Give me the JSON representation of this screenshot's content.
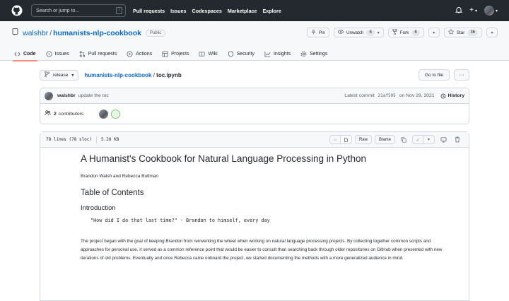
{
  "topbar": {
    "search_placeholder": "Search or jump to...",
    "search_shortcut": "/",
    "nav": [
      "Pull requests",
      "Issues",
      "Codespaces",
      "Marketplace",
      "Explore"
    ]
  },
  "repo": {
    "owner": "walshbr",
    "separator": "/",
    "name": "humanists-nlp-cookbook",
    "visibility": "Public",
    "pin_label": "Pin",
    "unwatch_label": "Unwatch",
    "watch_count": "6",
    "fork_label": "Fork",
    "fork_count": "6",
    "star_label": "Star",
    "star_count": "36"
  },
  "tabs": [
    {
      "label": "Code",
      "icon": "code-icon"
    },
    {
      "label": "Issues",
      "icon": "issue-icon"
    },
    {
      "label": "Pull requests",
      "icon": "pull-request-icon"
    },
    {
      "label": "Actions",
      "icon": "play-icon"
    },
    {
      "label": "Projects",
      "icon": "table-icon"
    },
    {
      "label": "Wiki",
      "icon": "book-icon"
    },
    {
      "label": "Security",
      "icon": "shield-icon"
    },
    {
      "label": "Insights",
      "icon": "graph-icon"
    },
    {
      "label": "Settings",
      "icon": "gear-icon"
    }
  ],
  "path": {
    "branch": "release",
    "repo_link": "humanists-nlp-cookbook",
    "separator": "/",
    "file": "toc.ipynb",
    "go_to_file": "Go to file",
    "more": "···"
  },
  "commit": {
    "author": "walshbr",
    "message": "update the toc",
    "latest_label": "Latest commit",
    "sha": "21af595",
    "date_prefix": "on",
    "date": "Nov 29, 2021",
    "history_label": "History",
    "contributors_count": "2",
    "contributors_label": "contributors"
  },
  "file": {
    "lines": "78 lines (78 sloc)",
    "size": "5.28 KB",
    "raw_label": "Raw",
    "blame_label": "Blame"
  },
  "notebook": {
    "title": "A Humanist's Cookbook for Natural Language Processing in Python",
    "authors": "Brandon Walsh and Rebecca Bultman",
    "toc_heading": "Table of Contents",
    "intro_heading": "Introduction",
    "quote": "\"How did I do that last time?\" - Brandon to himself, every day",
    "paragraph": "The project began with the goal of keeping Brandon from reinventing the wheel when working on natural language processing projects. By collecting together common scripts and approaches for personal use, it served as a common reference point that would be easier to consult than searching back through older repositories on GitHub when presented with new iterations of old problems. Eventually and once Rebecca came onboard the project, we started documenting the methods with a more generalized audience in mind."
  }
}
